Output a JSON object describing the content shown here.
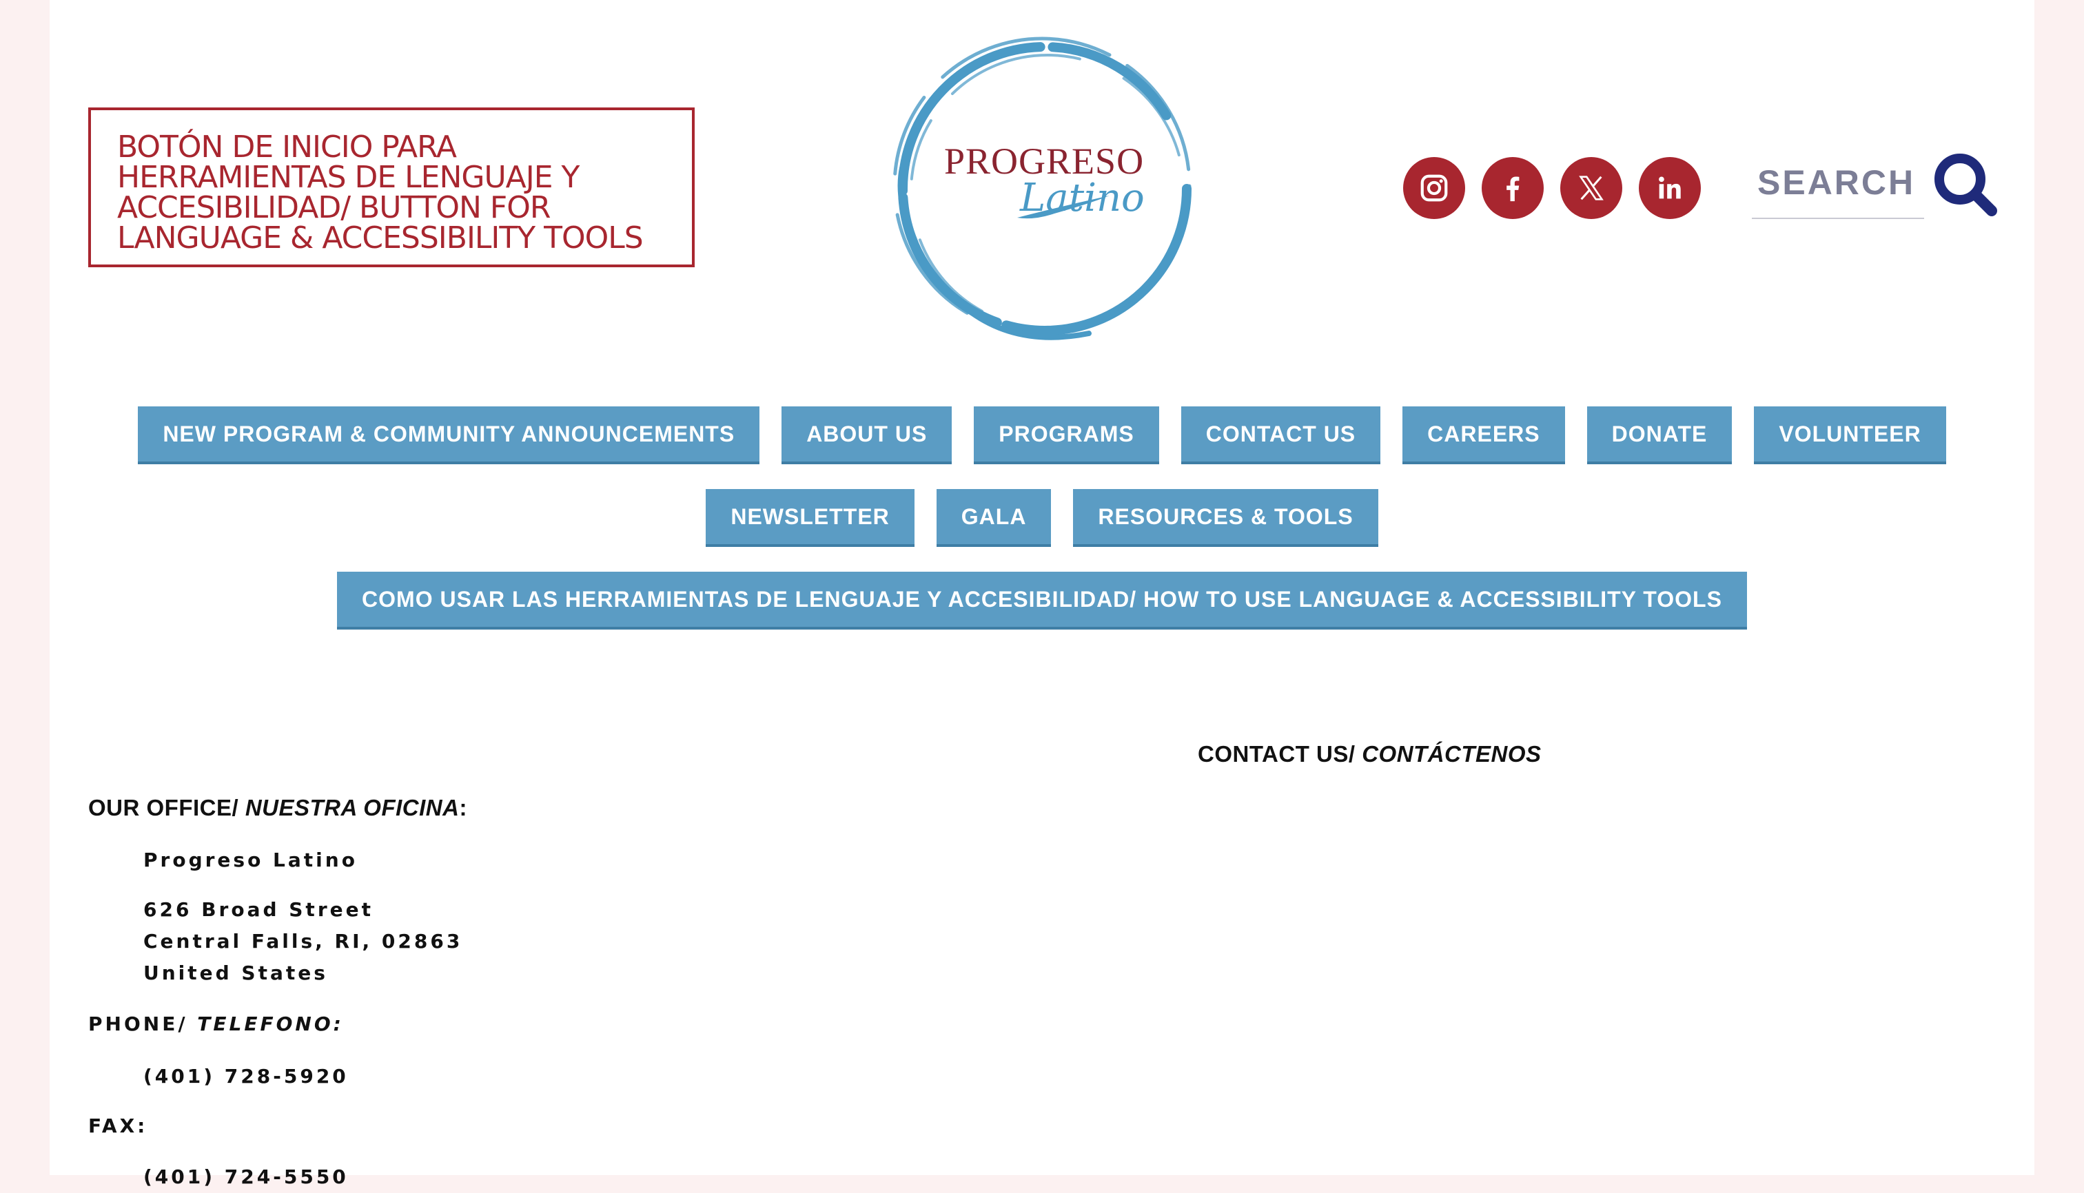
{
  "header": {
    "a11y_button_lines": [
      "BOTÓN DE INICIO PARA",
      "HERRAMIENTAS DE LENGUAJE Y",
      "ACCESIBILIDAD/ BUTTON FOR",
      "LANGUAGE & ACCESSIBILITY TOOLS"
    ],
    "logo": {
      "word1": "PROGRESO",
      "word2": "Latino"
    },
    "social": [
      {
        "name": "instagram",
        "icon": "instagram-icon"
      },
      {
        "name": "facebook",
        "icon": "facebook-icon"
      },
      {
        "name": "x",
        "icon": "x-icon"
      },
      {
        "name": "linkedin",
        "icon": "linkedin-icon"
      }
    ],
    "search": {
      "placeholder": "SEARCH",
      "icon": "search-icon"
    }
  },
  "nav": {
    "row1": [
      "NEW PROGRAM & COMMUNITY ANNOUNCEMENTS",
      "ABOUT US",
      "PROGRAMS",
      "CONTACT US",
      "CAREERS",
      "DONATE",
      "VOLUNTEER"
    ],
    "row2": [
      "NEWSLETTER",
      "GALA",
      "RESOURCES & TOOLS"
    ],
    "row3": [
      "COMO USAR LAS HERRAMIENTAS DE LENGUAJE Y ACCESIBILIDAD/ HOW TO USE LANGUAGE & ACCESSIBILITY TOOLS"
    ]
  },
  "content": {
    "contact_heading_plain": "CONTACT US/ ",
    "contact_heading_italic": "CONTÁCTENOS",
    "office_heading_plain": "OUR OFFICE/ ",
    "office_heading_italic": "NUESTRA OFICINA",
    "office_heading_colon": ":",
    "org_name": "Progreso Latino",
    "address_line1": "626 Broad Street",
    "address_line2": "Central Falls, RI, 02863",
    "address_line3": "United States",
    "phone_label_plain": "PHONE/ ",
    "phone_label_italic": "TELEFONO:",
    "phone": "(401) 728-5920",
    "fax_label": "FAX:",
    "fax": "(401) 724-5550"
  },
  "colors": {
    "brand_red": "#a8262f",
    "nav_blue": "#5b9cc4",
    "logo_blue": "#4a9ac6",
    "search_navy": "#1f2a7a",
    "page_bg": "#fcf1f1"
  }
}
